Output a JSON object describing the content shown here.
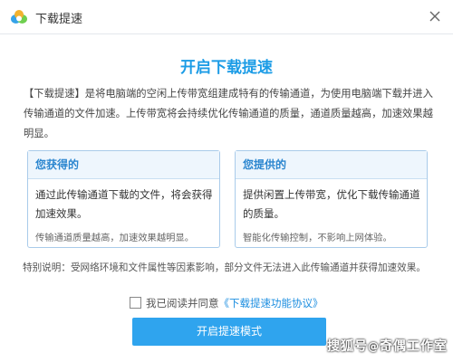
{
  "window": {
    "title": "下载提速",
    "app_icon": "cloud-logo-icon",
    "close_icon": "close-icon"
  },
  "headline": "开启下载提速",
  "description": "【下载提速】是将电脑端的空闲上传带宽组建成特有的传输通道，为使用电脑端下载并进入传输通道的文件加速。上传带宽将会持续优化传输通道的质量，通道质量越高，加速效果越明显。",
  "cards": [
    {
      "title": "您获得的",
      "body": "通过此传输通道下载的文件，将会获得加速效果。",
      "note": "传输通道质量越高，加速效果越明显。"
    },
    {
      "title": "您提供的",
      "body": "提供闲置上传带宽，优化下载传输通道的质量。",
      "note": "智能化传输控制，不影响上网体验。"
    }
  ],
  "special_note": "特别说明：受网络环境和文件属性等因素影响，部分文件无法进入此传输通道并获得加速效果。",
  "agreement": {
    "checked": false,
    "text": "我已阅读并同意",
    "link": "《下载提速功能协议》"
  },
  "primary_button": "开启提速模式",
  "watermark": {
    "prefix": "搜狐号",
    "at": "@",
    "name": "奇偶工作室"
  },
  "colors": {
    "accent": "#1c9ce6",
    "button": "#2fa4ee",
    "card_border": "#a9cbea",
    "card_header": "#eef6fd"
  }
}
